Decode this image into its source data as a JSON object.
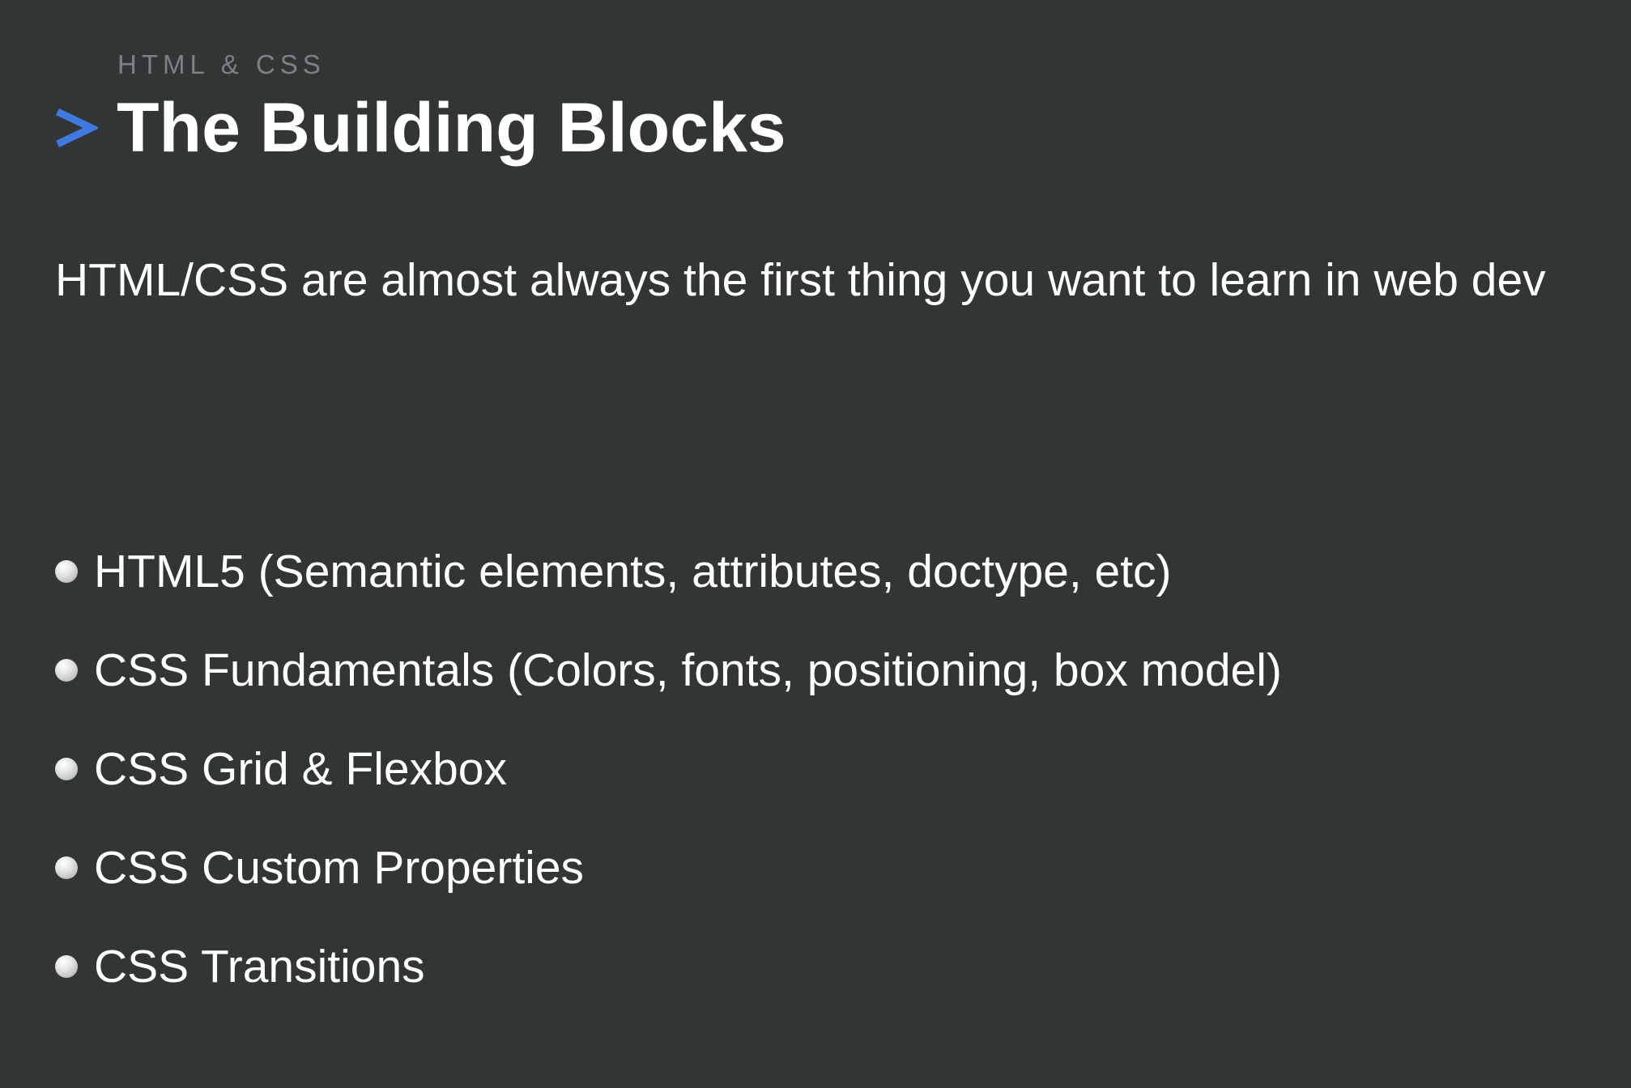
{
  "slide": {
    "eyebrow": "HTML & CSS",
    "title": "The Building Blocks",
    "intro": "HTML/CSS are almost always the first thing you want to learn in web dev",
    "bullets": [
      "HTML5 (Semantic elements, attributes, doctype, etc)",
      "CSS Fundamentals (Colors, fonts, positioning, box model)",
      "CSS Grid & Flexbox",
      "CSS Custom Properties",
      "CSS Transitions"
    ]
  },
  "icons": {
    "title_marker": "chevron-right-icon",
    "bullet_marker": "bullet-dot-icon"
  },
  "colors": {
    "background": "#323536",
    "text": "#ffffff",
    "eyebrow": "#7d8183",
    "accent": "#3f78df"
  }
}
